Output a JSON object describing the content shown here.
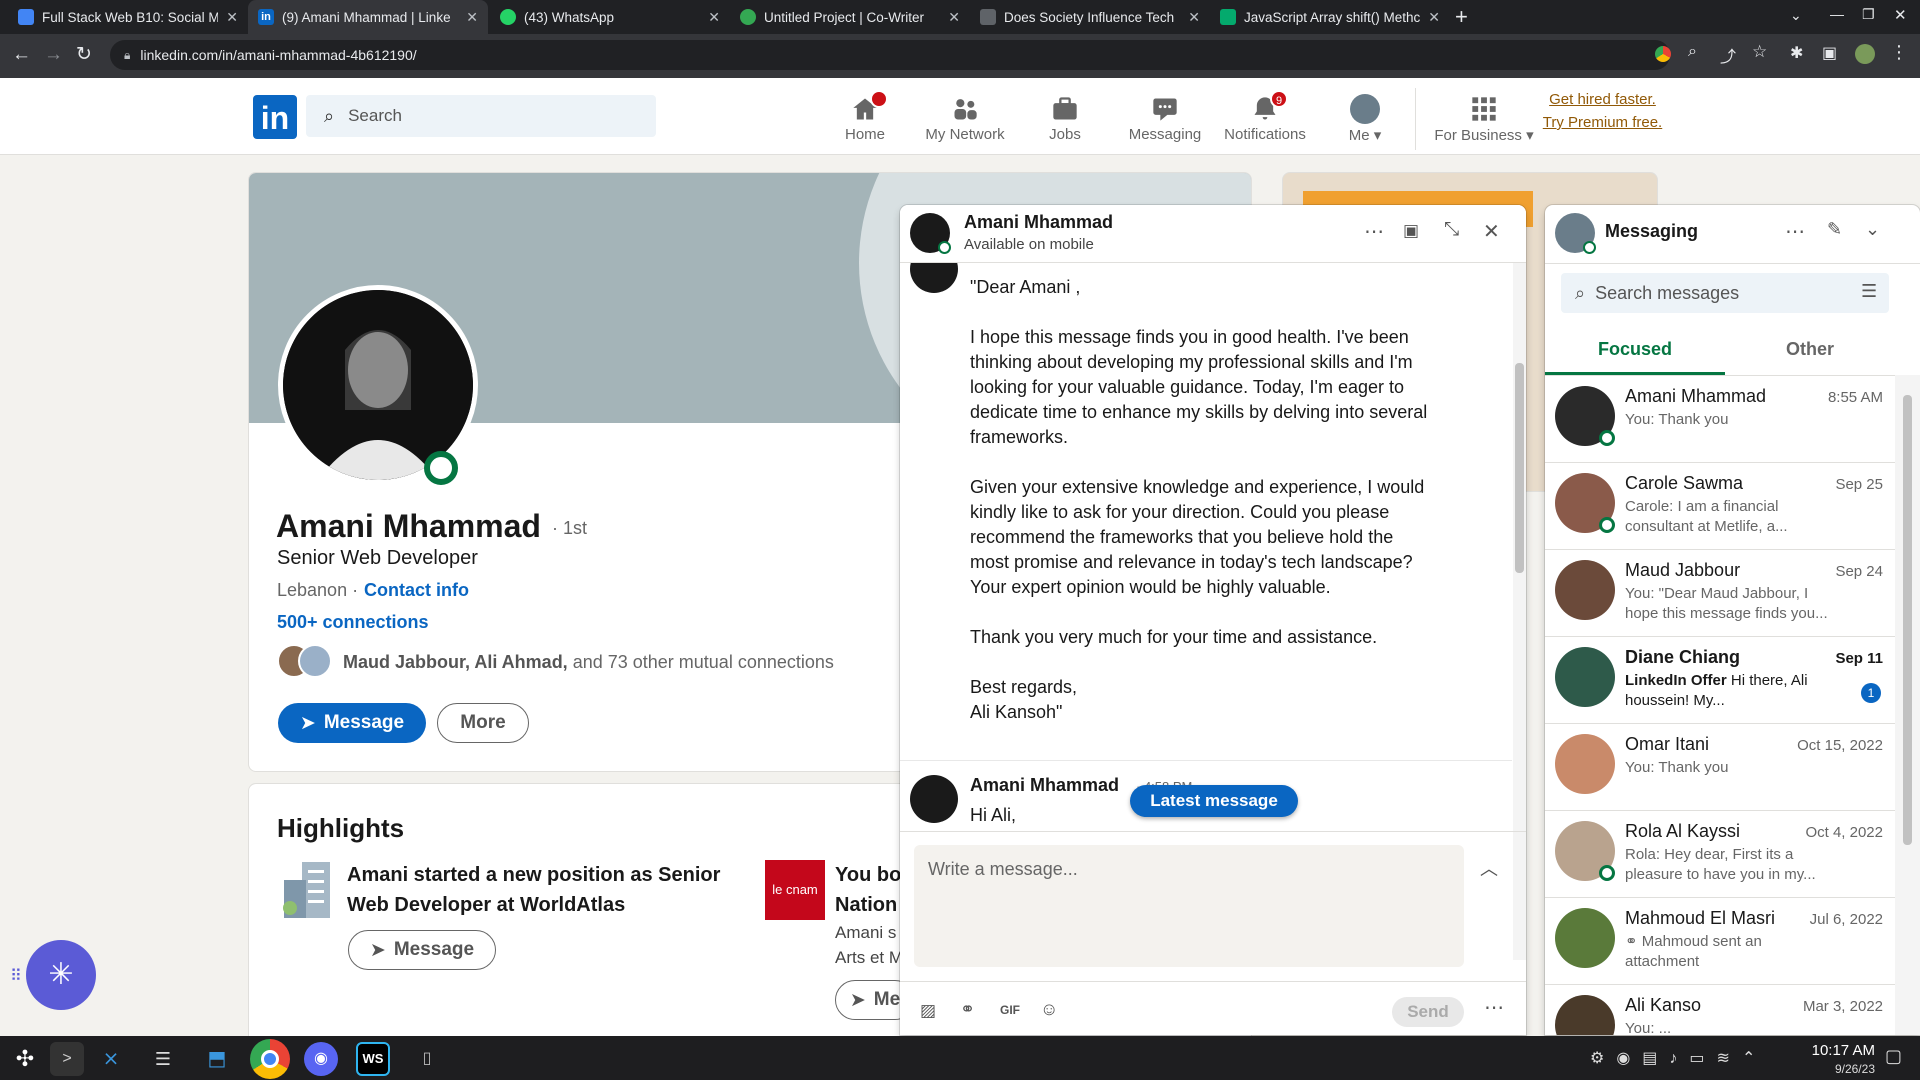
{
  "browser": {
    "tabs": [
      {
        "title": "Full Stack Web B10: Social M",
        "color": "#4285f4"
      },
      {
        "title": "(9) Amani Mhammad | Linke",
        "color": "#0a66c2"
      },
      {
        "title": "(43) WhatsApp",
        "color": "#25d366"
      },
      {
        "title": "Untitled Project | Co-Writer",
        "color": "#34a853"
      },
      {
        "title": "Does Society Influence Tech",
        "color": "#5f6368"
      },
      {
        "title": "JavaScript Array shift() Methc",
        "color": "#04aa6d"
      }
    ],
    "url": "linkedin.com/in/amani-mhammad-4b612190/"
  },
  "linkedin": {
    "logo": "in",
    "search_placeholder": "Search",
    "nav": [
      {
        "label": "Home",
        "badge": ""
      },
      {
        "label": "My Network",
        "badge": ""
      },
      {
        "label": "Jobs",
        "badge": ""
      },
      {
        "label": "Messaging",
        "badge": ""
      },
      {
        "label": "Notifications",
        "badge": "9"
      },
      {
        "label": "Me",
        "badge": ""
      },
      {
        "label": "For Business",
        "badge": ""
      }
    ],
    "premium": "Get hired faster. Try Premium free."
  },
  "profile": {
    "name": "Amani Mhammad",
    "degree": "· 1st",
    "headline": "Senior Web Developer",
    "location": "Lebanon ·",
    "contact": "Contact info",
    "connections": "500+ connections",
    "mutual_names": "Maud Jabbour, Ali Ahmad,",
    "mutual_rest": "and 73 other mutual connections",
    "message_btn": "Message",
    "more_btn": "More"
  },
  "highlights": {
    "title": "Highlights",
    "item1": "Amani started a new position as Senior Web Developer at WorldAtlas",
    "item1_btn": "Message",
    "item2_logo": "le cnam",
    "item2_title_a": "You bo",
    "item2_title_b": "Nation",
    "item2_sub_a": "Amani s",
    "item2_sub_b": "Arts et M",
    "item2_btn": "Me"
  },
  "chat": {
    "name": "Amani Mhammad",
    "status": "Available on mobile",
    "message": [
      "\"Dear Amani ,",
      "I hope this message finds you in good health. I've been thinking about developing my professional skills and I'm looking for your valuable guidance. Today, I'm eager to dedicate time to enhance my skills by delving into several frameworks.",
      "Given your extensive knowledge and experience, I would kindly like to ask for your direction. Could you please recommend the frameworks that you believe hold the most promise and relevance in today's tech landscape? Your expert opinion would be highly valuable.",
      "Thank you very much for your time and assistance.",
      "Best regards,",
      "Ali Kansoh\""
    ],
    "reply_name": "Amani Mhammad",
    "reply_time": "· 4:58 PM",
    "reply_text": "Hi Ali,",
    "latest_btn": "Latest message",
    "input_placeholder": "Write a message...",
    "send": "Send"
  },
  "messaging": {
    "title": "Messaging",
    "search_placeholder": "Search messages",
    "tabs": [
      "Focused",
      "Other"
    ],
    "conversations": [
      {
        "name": "Amani Mhammad",
        "date": "8:55 AM",
        "preview": "You: Thank you",
        "online": true,
        "bold": false,
        "avatar": "#2a2a2a"
      },
      {
        "name": "Carole Sawma",
        "date": "Sep 25",
        "preview": "Carole: I am a financial consultant at Metlife, a...",
        "online": true,
        "bold": false,
        "avatar": "#8a5a4a"
      },
      {
        "name": "Maud Jabbour",
        "date": "Sep 24",
        "preview": "You: \"Dear Maud Jabbour, I hope this message finds you...",
        "online": false,
        "bold": false,
        "avatar": "#6b4a3a"
      },
      {
        "name": "Diane Chiang",
        "date": "Sep 11",
        "preview": "Hi there, Ali houssein! My...",
        "sponsor": "LinkedIn Offer",
        "online": false,
        "bold": true,
        "unread": "1",
        "avatar": "#2e5a4a"
      },
      {
        "name": "Omar Itani",
        "date": "Oct 15, 2022",
        "preview": "You: Thank you",
        "online": false,
        "bold": false,
        "avatar": "#c98a6a"
      },
      {
        "name": "Rola Al Kayssi",
        "date": "Oct 4, 2022",
        "preview": "Rola: Hey dear, First its a pleasure to have you in my...",
        "online": true,
        "bold": false,
        "avatar": "#b9a38e"
      },
      {
        "name": "Mahmoud El Masri",
        "date": "Jul 6, 2022",
        "preview": "Mahmoud sent an attachment",
        "online": false,
        "bold": false,
        "avatar": "#5a7a3a"
      },
      {
        "name": "Ali Kanso",
        "date": "Mar 3, 2022",
        "preview": "You: ...",
        "online": false,
        "bold": false,
        "avatar": "#4a3a2a"
      }
    ]
  },
  "taskbar": {
    "time": "10:17 AM",
    "date": "9/26/23"
  }
}
